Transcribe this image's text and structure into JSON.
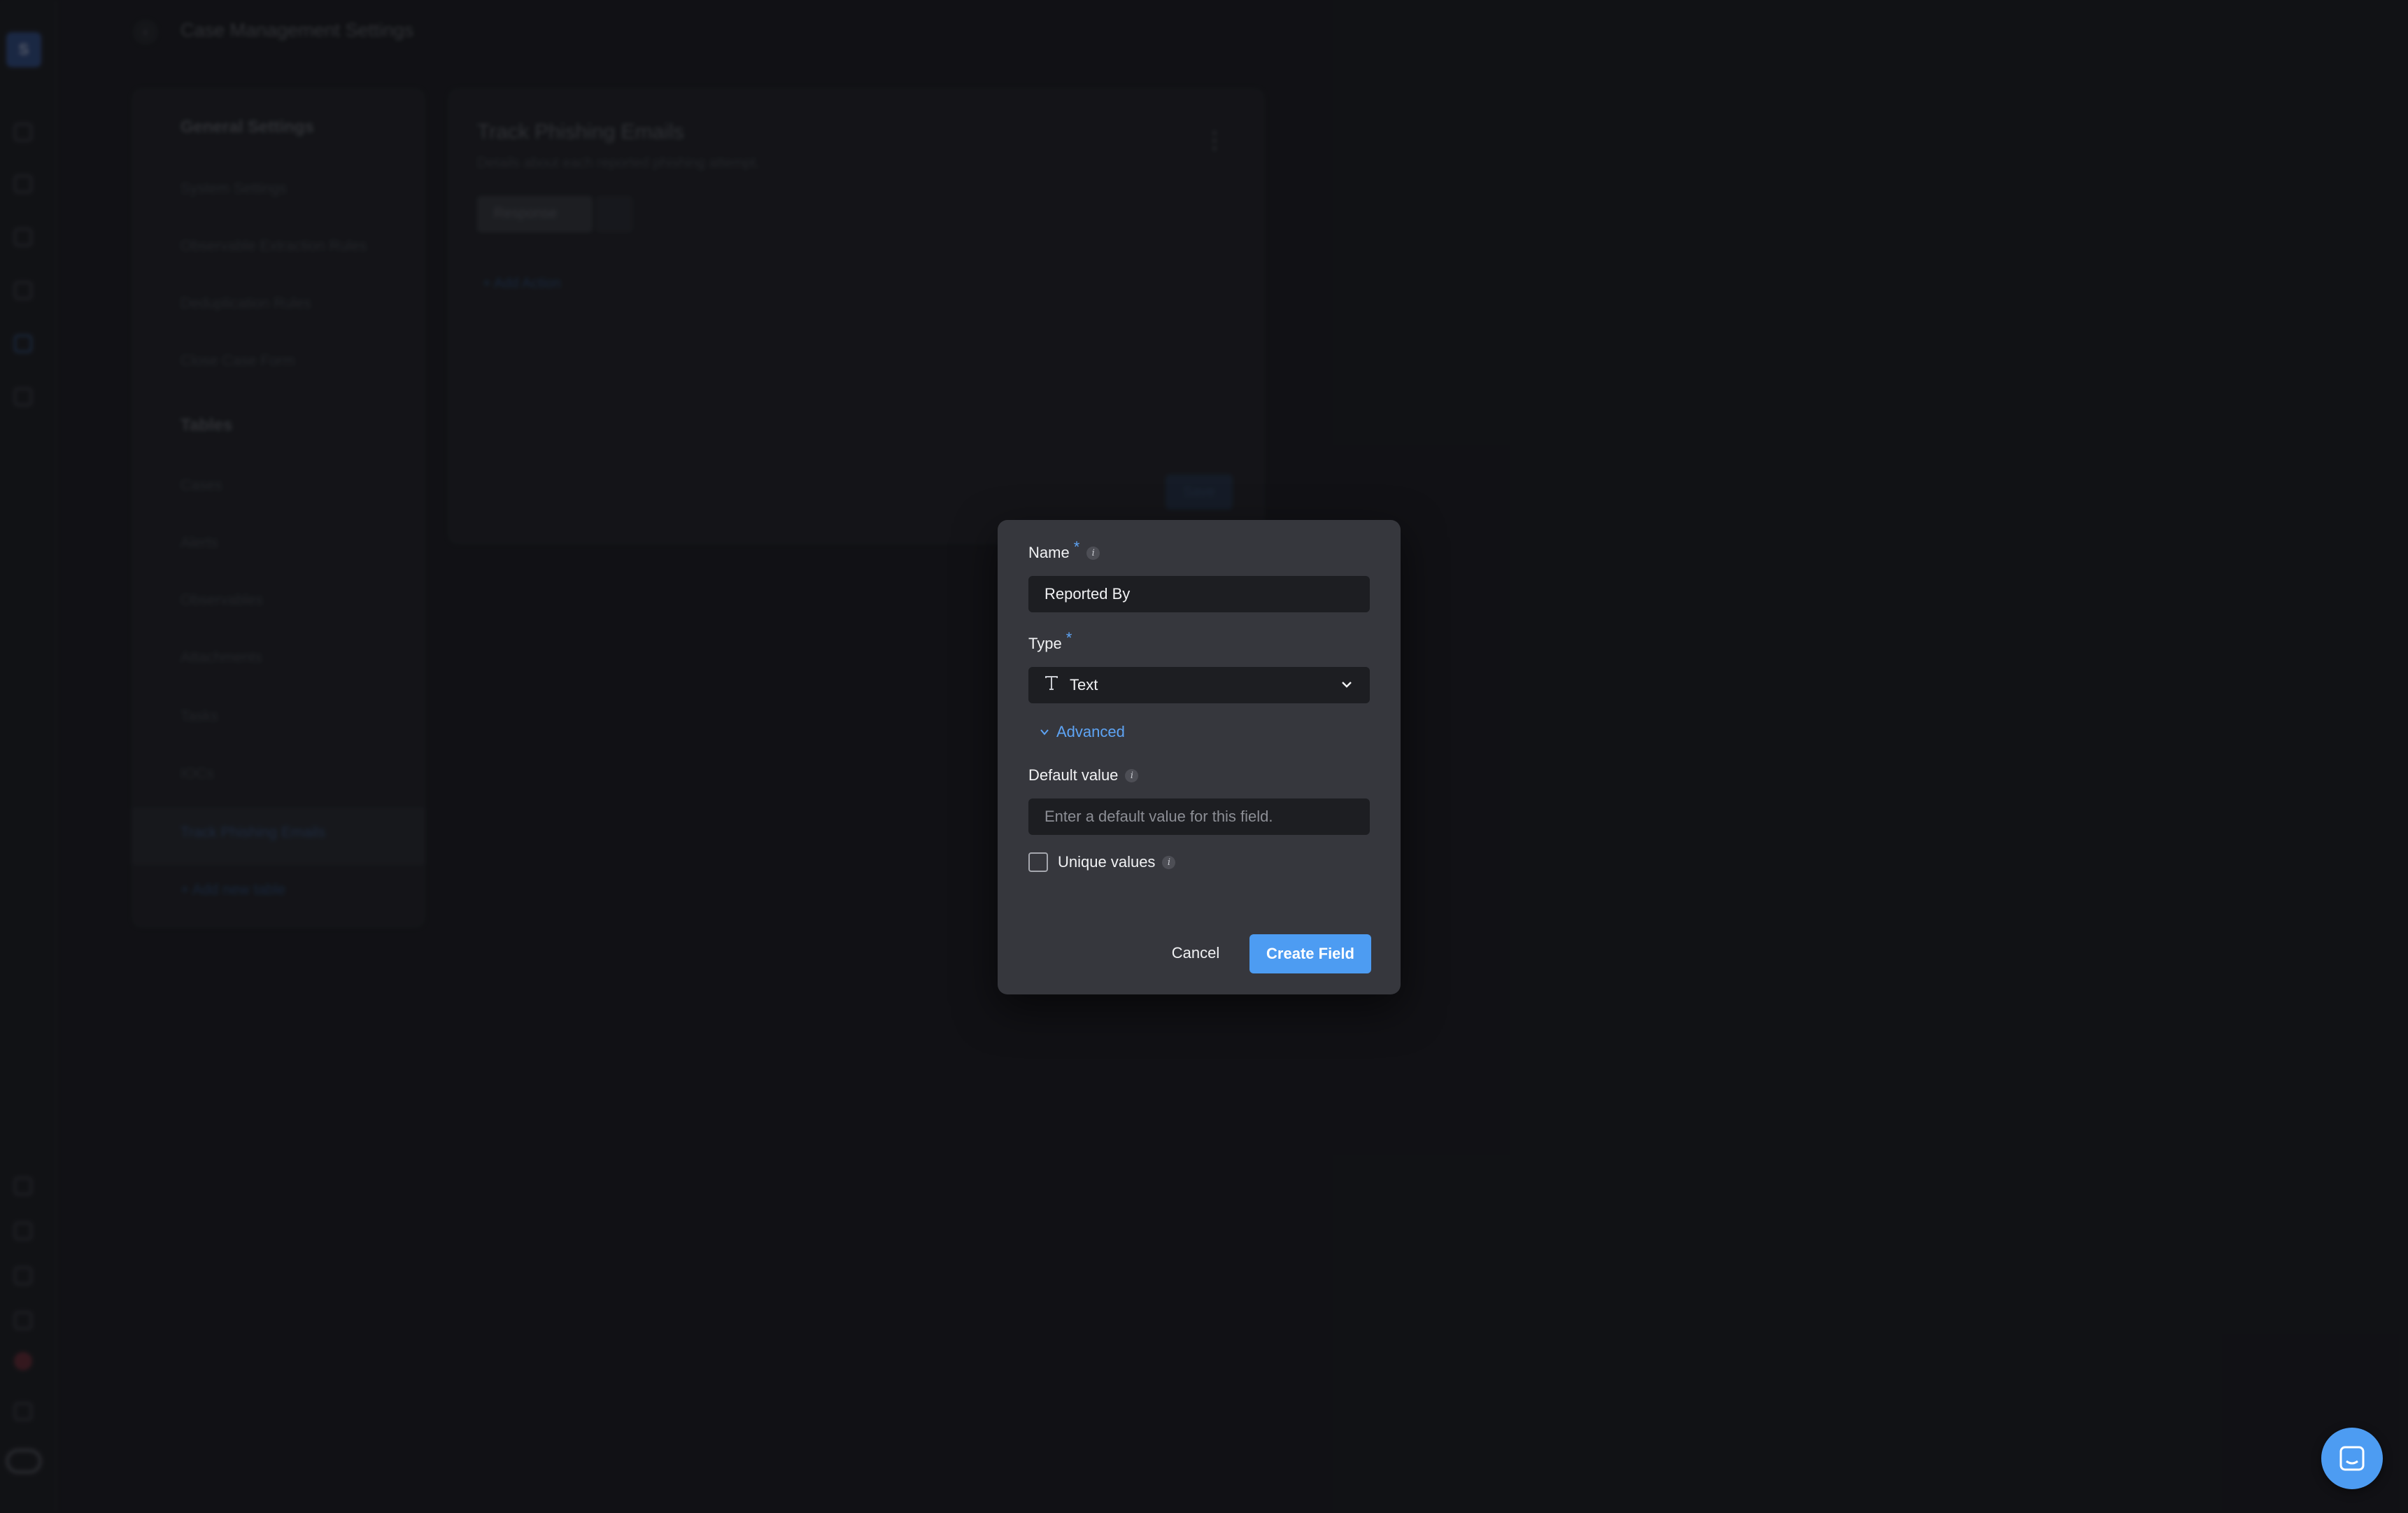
{
  "background": {
    "rail": {
      "logo_letter": "S"
    },
    "header": {
      "title": "Case Management Settings"
    },
    "nav": {
      "general_section": "General Settings",
      "general_items": [
        "System Settings",
        "Observable Extraction Rules",
        "Deduplication Rules",
        "Close Case Form"
      ],
      "tables_section": "Tables",
      "table_items": [
        "Cases",
        "Alerts",
        "Observables",
        "Attachments",
        "Tasks",
        "IOCs",
        "Track Phishing Emails"
      ],
      "add_table": "+ Add new table"
    },
    "table_card": {
      "title": "Track Phishing Emails",
      "subtitle": "Details about each reported phishing attempt.",
      "chip": "Response",
      "add_action": "+ Add Action",
      "save": "Save"
    }
  },
  "modal": {
    "name_label": "Name",
    "required_mark": "*",
    "info_glyph": "i",
    "name_value": "Reported By",
    "type_label": "Type",
    "type_value": "Text",
    "advanced_label": "Advanced",
    "default_label": "Default value",
    "default_placeholder": "Enter a default value for this field.",
    "unique_label": "Unique values",
    "cancel": "Cancel",
    "create": "Create Field"
  },
  "colors": {
    "accent": "#4d9cf2",
    "modal_bg": "#36373d",
    "page_bg": "#141518"
  }
}
